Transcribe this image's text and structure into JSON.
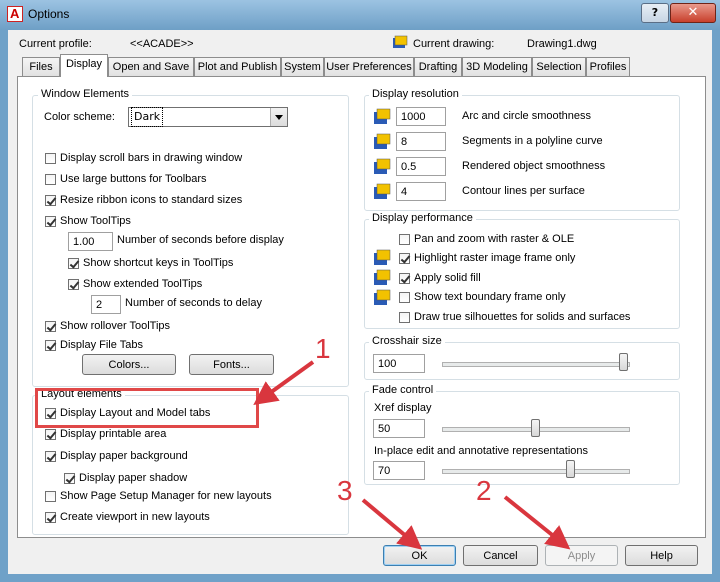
{
  "window": {
    "title": "Options",
    "help_label": "?",
    "close_label": "✕"
  },
  "profile": {
    "current_profile_label": "Current profile:",
    "current_profile_value": "<<ACADE>>",
    "current_drawing_label": "Current drawing:",
    "current_drawing_value": "Drawing1.dwg"
  },
  "tabs": [
    {
      "label": "Files"
    },
    {
      "label": "Display",
      "active": true
    },
    {
      "label": "Open and Save"
    },
    {
      "label": "Plot and Publish"
    },
    {
      "label": "System"
    },
    {
      "label": "User Preferences"
    },
    {
      "label": "Drafting"
    },
    {
      "label": "3D Modeling"
    },
    {
      "label": "Selection"
    },
    {
      "label": "Profiles"
    }
  ],
  "window_elements": {
    "title": "Window Elements",
    "color_scheme_label": "Color scheme:",
    "color_scheme_value": "Dark",
    "display_scroll_bars": {
      "label": "Display scroll bars in drawing window",
      "checked": false
    },
    "use_large_buttons": {
      "label": "Use large buttons for Toolbars",
      "checked": false
    },
    "resize_ribbon_icons": {
      "label": "Resize ribbon icons to standard sizes",
      "checked": true
    },
    "show_tooltips": {
      "label": "Show ToolTips",
      "checked": true
    },
    "tooltip_seconds_value": "1.00",
    "tooltip_seconds_label": "Number of seconds before display",
    "show_shortcut_keys": {
      "label": "Show shortcut keys in ToolTips",
      "checked": true
    },
    "show_extended_tooltips": {
      "label": "Show extended ToolTips",
      "checked": true
    },
    "extended_delay_value": "2",
    "extended_delay_label": "Number of seconds to delay",
    "show_rollover_tooltips": {
      "label": "Show rollover ToolTips",
      "checked": true
    },
    "display_file_tabs": {
      "label": "Display File Tabs",
      "checked": true
    },
    "colors_button": "Colors...",
    "fonts_button": "Fonts..."
  },
  "layout_elements": {
    "title": "Layout elements",
    "display_layout_model_tabs": {
      "label": "Display Layout and Model tabs",
      "checked": true
    },
    "display_printable_area": {
      "label": "Display printable area",
      "checked": true
    },
    "display_paper_background": {
      "label": "Display paper background",
      "checked": true
    },
    "display_paper_shadow": {
      "label": "Display paper shadow",
      "checked": true
    },
    "show_page_setup_manager": {
      "label": "Show Page Setup Manager for new layouts",
      "checked": false
    },
    "create_viewport": {
      "label": "Create viewport in new layouts",
      "checked": true
    }
  },
  "display_resolution": {
    "title": "Display resolution",
    "rows": [
      {
        "value": "1000",
        "label": "Arc and circle smoothness"
      },
      {
        "value": "8",
        "label": "Segments in a polyline curve"
      },
      {
        "value": "0.5",
        "label": "Rendered object smoothness"
      },
      {
        "value": "4",
        "label": "Contour lines per surface"
      }
    ]
  },
  "display_performance": {
    "title": "Display performance",
    "pan_zoom_raster": {
      "label": "Pan and zoom with raster & OLE",
      "checked": false
    },
    "highlight_raster": {
      "label": "Highlight raster image frame only",
      "checked": true
    },
    "apply_solid_fill": {
      "label": "Apply solid fill",
      "checked": true
    },
    "show_text_boundary": {
      "label": "Show text boundary frame only",
      "checked": false
    },
    "draw_true_silhouettes": {
      "label": "Draw true silhouettes for solids and surfaces",
      "checked": false
    }
  },
  "crosshair": {
    "title": "Crosshair size",
    "value": "100",
    "level_fraction": 1.0
  },
  "fade_control": {
    "title": "Fade control",
    "xref_label": "Xref display",
    "xref_value": "50",
    "xref_fraction": 0.5,
    "inplace_label": "In-place edit and annotative representations",
    "inplace_value": "70",
    "inplace_fraction": 0.7
  },
  "buttons": {
    "ok": "OK",
    "cancel": "Cancel",
    "apply": "Apply",
    "help": "Help"
  },
  "annotations": {
    "callout_1": "1",
    "callout_2": "2",
    "callout_3": "3",
    "color": "#d9363e"
  }
}
